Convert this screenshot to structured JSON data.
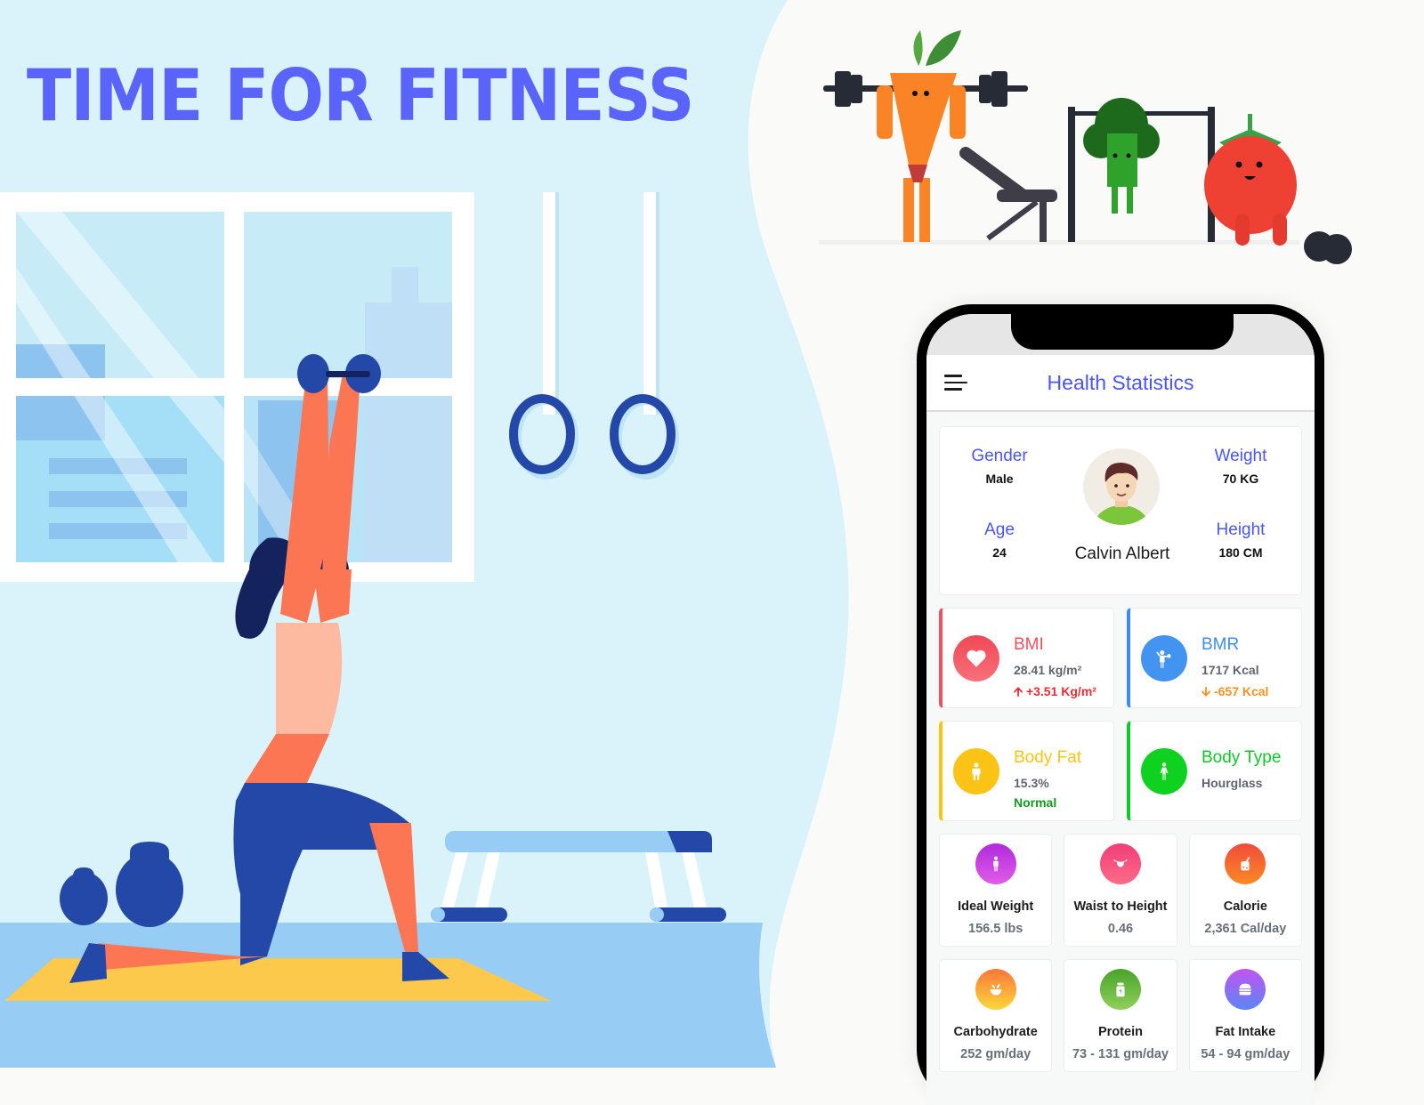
{
  "hero": {
    "title": "TIME FOR FITNESS"
  },
  "colors": {
    "accent": "#4b55f0",
    "hero_title": "#5a63fa",
    "bg_light_blue": "#daf3fa",
    "bg_right": "#fafaf8",
    "floor": "#97ccf5",
    "bmi": "#f1505e",
    "bmr": "#3b8ef0",
    "body_fat": "#fbc315",
    "body_type": "#12c92a",
    "normal_status": "#119a1d",
    "bmr_delta": "#f4921d"
  },
  "app": {
    "title": "Health Statistics",
    "menu_icon": "hamburger-menu-icon"
  },
  "profile": {
    "name": "Calvin Albert",
    "gender_label": "Gender",
    "gender": "Male",
    "age_label": "Age",
    "age": "24",
    "weight_label": "Weight",
    "weight": "70 KG",
    "height_label": "Height",
    "height": "180 CM"
  },
  "metrics": [
    {
      "title": "BMI",
      "value": "28.41 kg/m²",
      "delta": "+3.51 Kg/m²",
      "delta_direction": "up",
      "icon": "heart-icon"
    },
    {
      "title": "BMR",
      "value": "1717 Kcal",
      "delta": "-657 Kcal",
      "delta_direction": "down",
      "icon": "person-waving-icon"
    },
    {
      "title": "Body Fat",
      "value": "15.3%",
      "status": "Normal",
      "icon": "body-fat-icon"
    },
    {
      "title": "Body Type",
      "value": "Hourglass",
      "icon": "body-type-icon"
    }
  ],
  "stats": [
    {
      "title": "Ideal Weight",
      "value": "156.5 lbs",
      "icon": "ideal-weight-icon"
    },
    {
      "title": "Waist to Height",
      "value": "0.46",
      "icon": "waist-icon"
    },
    {
      "title": "Calorie",
      "value": "2,361 Cal/day",
      "icon": "calorie-jar-icon"
    },
    {
      "title": "Carbohydrate",
      "value": "252 gm/day",
      "icon": "salad-bowl-icon"
    },
    {
      "title": "Protein",
      "value": "73 - 131 gm/day",
      "icon": "protein-jar-icon"
    },
    {
      "title": "Fat Intake",
      "value": "54 - 94 gm/day",
      "icon": "burger-icon"
    }
  ]
}
